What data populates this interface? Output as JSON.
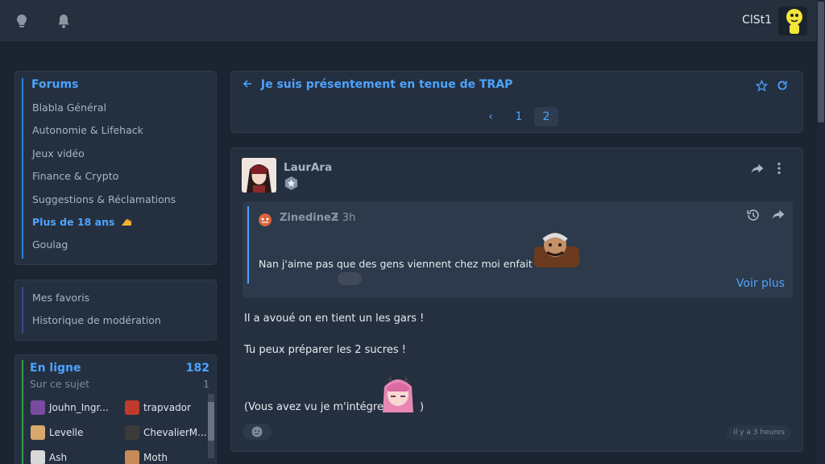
{
  "header": {
    "username": "ClSt1",
    "icons": [
      "lightbulb-icon",
      "bell-icon"
    ]
  },
  "sidebar": {
    "forums_title": "Forums",
    "forums": [
      {
        "label": "Blabla Général"
      },
      {
        "label": "Autonomie & Lifehack"
      },
      {
        "label": "Jeux vidéo"
      },
      {
        "label": "Finance & Crypto"
      },
      {
        "label": "Suggestions & Réclamations"
      },
      {
        "label": "Plus de 18 ans",
        "active": true
      },
      {
        "label": "Goulag"
      }
    ],
    "links": [
      {
        "label": "Mes favoris"
      },
      {
        "label": "Historique de modération"
      }
    ],
    "online": {
      "title": "En ligne",
      "count": "182",
      "subtitle": "Sur ce sujet",
      "subtitle_count": "1",
      "users": [
        "Jouhn_Ingr...",
        "trapvador",
        "Levelle",
        "ChevalierM...",
        "Ash",
        "Moth"
      ]
    }
  },
  "topic": {
    "title": "Je suis présentement en tenue de TRAP",
    "pages": [
      "1",
      "2"
    ],
    "current_page": "2"
  },
  "post": {
    "author": "LaurAra",
    "quote": {
      "author": "ZinedineZ",
      "time": "• 3h",
      "text": "Nan j'aime pas que des gens viennent chez moi enfait",
      "more": "Voir plus"
    },
    "lines": [
      "Il a avoué on en tient un les gars !",
      "Tu peux préparer les 2 sucres !",
      "(Vous avez vu je m'intégre",
      ")"
    ],
    "timestamp": "il y a 3 heures"
  },
  "colors": {
    "accent": "#4ea3ff",
    "background": "#1b2532",
    "card": "#243040",
    "online": "#3aa04a"
  }
}
